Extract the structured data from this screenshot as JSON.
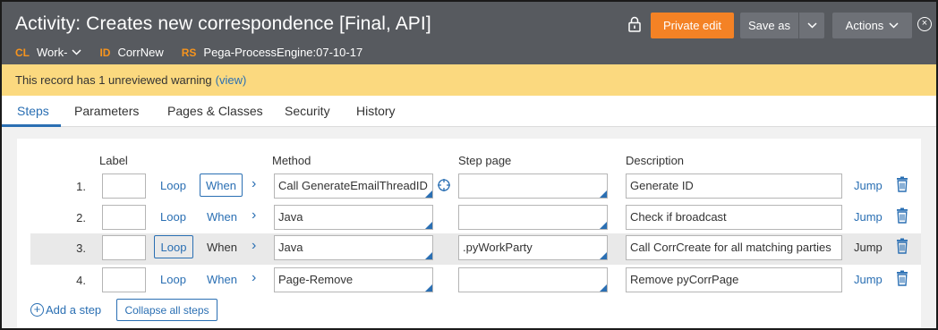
{
  "header": {
    "title": "Activity: Creates new correspondence [Final, API]",
    "class_key": "CL",
    "class_value": "Work-",
    "id_key": "ID",
    "id_value": "CorrNew",
    "rs_key": "RS",
    "rs_value": "Pega-ProcessEngine:07-10-17",
    "private_edit_label": "Private edit",
    "save_as_label": "Save as",
    "actions_label": "Actions"
  },
  "warning": {
    "text": "This record has 1 unreviewed warning",
    "link": "(view)"
  },
  "tabs": [
    {
      "label": "Steps"
    },
    {
      "label": "Parameters"
    },
    {
      "label": "Pages & Classes"
    },
    {
      "label": "Security"
    },
    {
      "label": "History"
    }
  ],
  "columns": {
    "label": "Label",
    "method": "Method",
    "step_page": "Step page",
    "description": "Description"
  },
  "steps": [
    {
      "num": "1.",
      "label": "",
      "loop": "Loop",
      "when": "When",
      "method": "Call GenerateEmailThreadID",
      "step_page": "",
      "description": "Generate ID",
      "jump": "Jump"
    },
    {
      "num": "2.",
      "label": "",
      "loop": "Loop",
      "when": "When",
      "method": "Java",
      "step_page": "",
      "description": "Check if broadcast",
      "jump": "Jump"
    },
    {
      "num": "3.",
      "label": "",
      "loop": "Loop",
      "when": "When",
      "method": "Java",
      "step_page": ".pyWorkParty",
      "description": "Call CorrCreate for all matching parties",
      "jump": "Jump"
    },
    {
      "num": "4.",
      "label": "",
      "loop": "Loop",
      "when": "When",
      "method": "Page-Remove",
      "step_page": "",
      "description": "Remove pyCorrPage",
      "jump": "Jump"
    }
  ],
  "footer": {
    "add_step": "Add a step",
    "collapse_all": "Collapse all steps"
  },
  "colors": {
    "header_bg": "#575a5f",
    "accent_orange": "#f48225",
    "link_blue": "#2a6fb3",
    "warning_bg": "#fbd97f"
  }
}
